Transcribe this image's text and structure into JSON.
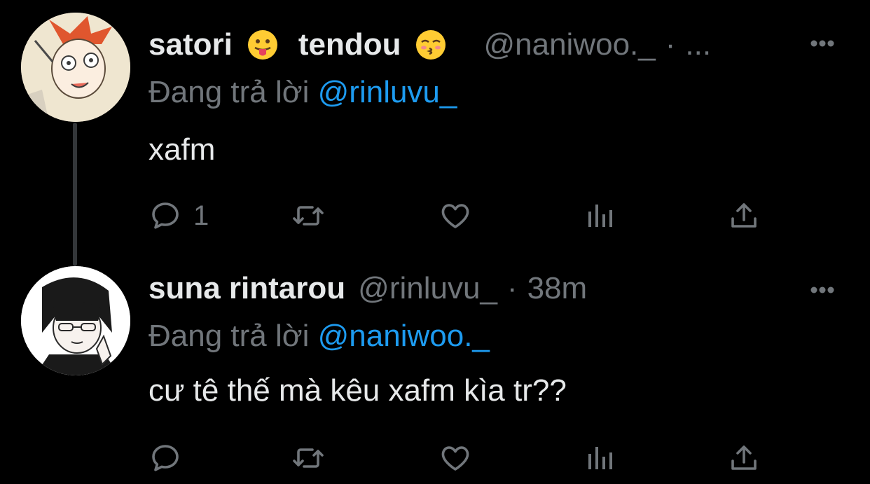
{
  "tweets": [
    {
      "name_part1": "satori",
      "name_part2": "tendou",
      "handle": "@naniwoo._",
      "separator": "·",
      "time": "...",
      "reply_prefix": "Đang trả lời",
      "reply_mention": "@rinluvu_",
      "text": "xafm",
      "reply_count": "1",
      "emoji1": "face-with-tongue-emoji",
      "emoji2": "kissing-face-emoji"
    },
    {
      "name": "suna rintarou",
      "handle": "@rinluvu_",
      "separator": "·",
      "time": "38m",
      "reply_prefix": "Đang trả lời",
      "reply_mention": "@naniwoo._",
      "text": "cư tê thế mà kêu xafm kìa tr??",
      "reply_count": ""
    }
  ],
  "colors": {
    "background": "#000000",
    "primary_text": "#e7e9ea",
    "secondary_text": "#71767b",
    "accent": "#1d9bf0",
    "thread_line": "#333639"
  },
  "icons": [
    "reply-icon",
    "retweet-icon",
    "like-icon",
    "views-icon",
    "share-icon",
    "more-icon"
  ]
}
